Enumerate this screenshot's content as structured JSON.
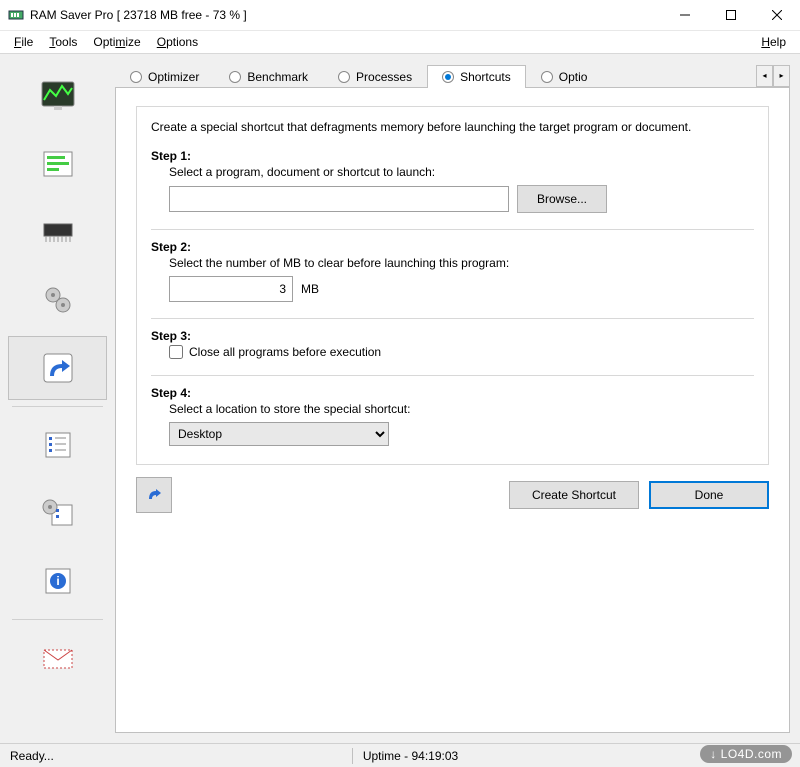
{
  "window": {
    "title": "RAM Saver Pro [ 23718 MB free - 73 % ]"
  },
  "menu": {
    "file": "File",
    "tools": "Tools",
    "optimize": "Optimize",
    "options": "Options",
    "help": "Help"
  },
  "tabs": {
    "optimizer": "Optimizer",
    "benchmark": "Benchmark",
    "processes": "Processes",
    "shortcuts": "Shortcuts",
    "options": "Optio"
  },
  "panel": {
    "intro": "Create a special shortcut that defragments memory before launching the target program or document.",
    "step1_title": "Step 1:",
    "step1_desc": "Select a program, document or shortcut to launch:",
    "program_value": "",
    "browse_label": "Browse...",
    "step2_title": "Step 2:",
    "step2_desc": "Select the number of MB to clear before launching this program:",
    "mb_value": "3",
    "mb_unit": "MB",
    "step3_title": "Step 3:",
    "step3_check": "Close all programs before execution",
    "step4_title": "Step 4:",
    "step4_desc": "Select a location to store the special shortcut:",
    "location_value": "Desktop"
  },
  "buttons": {
    "create": "Create Shortcut",
    "done": "Done"
  },
  "status": {
    "left": "Ready...",
    "right": "Uptime - 94:19:03"
  },
  "watermark": "LO4D.com"
}
